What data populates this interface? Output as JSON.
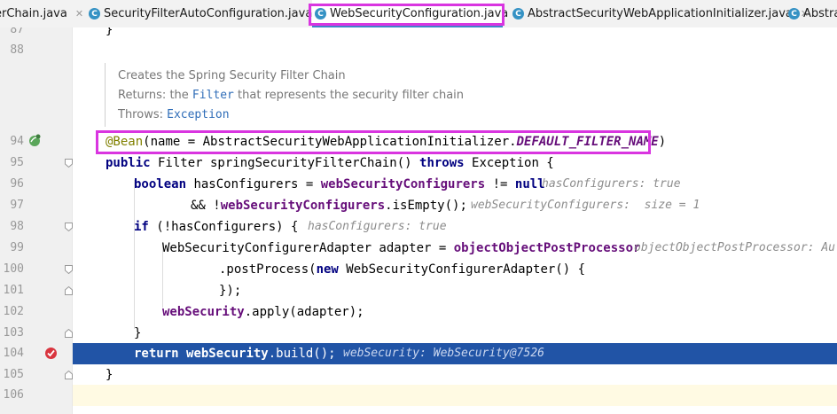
{
  "tabs": [
    {
      "label": "erChain.java",
      "icon": "class-icon",
      "active": false
    },
    {
      "label": "SecurityFilterAutoConfiguration.java",
      "icon": "class-icon",
      "active": false
    },
    {
      "label": "WebSecurityConfiguration.java",
      "icon": "class-icon",
      "active": true
    },
    {
      "label": "AbstractSecurityWebApplicationInitializer.java",
      "icon": "class-icon",
      "active": false
    },
    {
      "label": "Abstra",
      "icon": "class-icon",
      "active": false
    }
  ],
  "doc": {
    "summary": "Creates the Spring Security Filter Chain",
    "returns_label": "Returns:",
    "returns_the": "the",
    "returns_type": "Filter",
    "returns_rest": "that represents the security filter chain",
    "throws_label": "Throws:",
    "throws_type": "Exception"
  },
  "lines": [
    {
      "num": "87",
      "text": "}"
    },
    {
      "num": "88",
      "text": ""
    },
    {
      "num": "94",
      "annot": "@Bean",
      "rest1": "(name = AbstractSecurityWebApplicationInitializer.",
      "const": "DEFAULT_FILTER_NAME",
      "rest2": ")"
    },
    {
      "num": "95",
      "kw1": "public",
      "t1": " Filter springSecurityFilterChain() ",
      "kw2": "throws",
      "t2": " Exception {"
    },
    {
      "num": "96",
      "kw1": "boolean",
      "t1": " hasConfigurers = ",
      "f1": "webSecurityConfigurers",
      "t2": " != ",
      "kw2": "null",
      "hint": "hasConfigurers: true"
    },
    {
      "num": "97",
      "t1": "&& !",
      "f1": "webSecurityConfigurers",
      "t2": ".isEmpty();",
      "hint": "webSecurityConfigurers:  size = 1"
    },
    {
      "num": "98",
      "kw1": "if",
      "t1": " (!hasConfigurers) {",
      "hint": "hasConfigurers: true"
    },
    {
      "num": "99",
      "t1": "WebSecurityConfigurerAdapter adapter = ",
      "f1": "objectObjectPostProcessor",
      "hint": "objectObjectPostProcessor: Au"
    },
    {
      "num": "100",
      "t1": ".postProcess(",
      "kw1": "new",
      "t2": " WebSecurityConfigurerAdapter() {"
    },
    {
      "num": "101",
      "t1": "});"
    },
    {
      "num": "102",
      "f1": "webSecurity",
      "t1": ".apply(adapter);"
    },
    {
      "num": "103",
      "t1": "}"
    },
    {
      "num": "104",
      "kw1": "return",
      "t1": " ",
      "f1": "webSecurity",
      "t2": ".build();",
      "hint": "webSecurity: WebSecurity@7526"
    },
    {
      "num": "105",
      "t1": "}"
    },
    {
      "num": "106",
      "t1": ""
    }
  ]
}
